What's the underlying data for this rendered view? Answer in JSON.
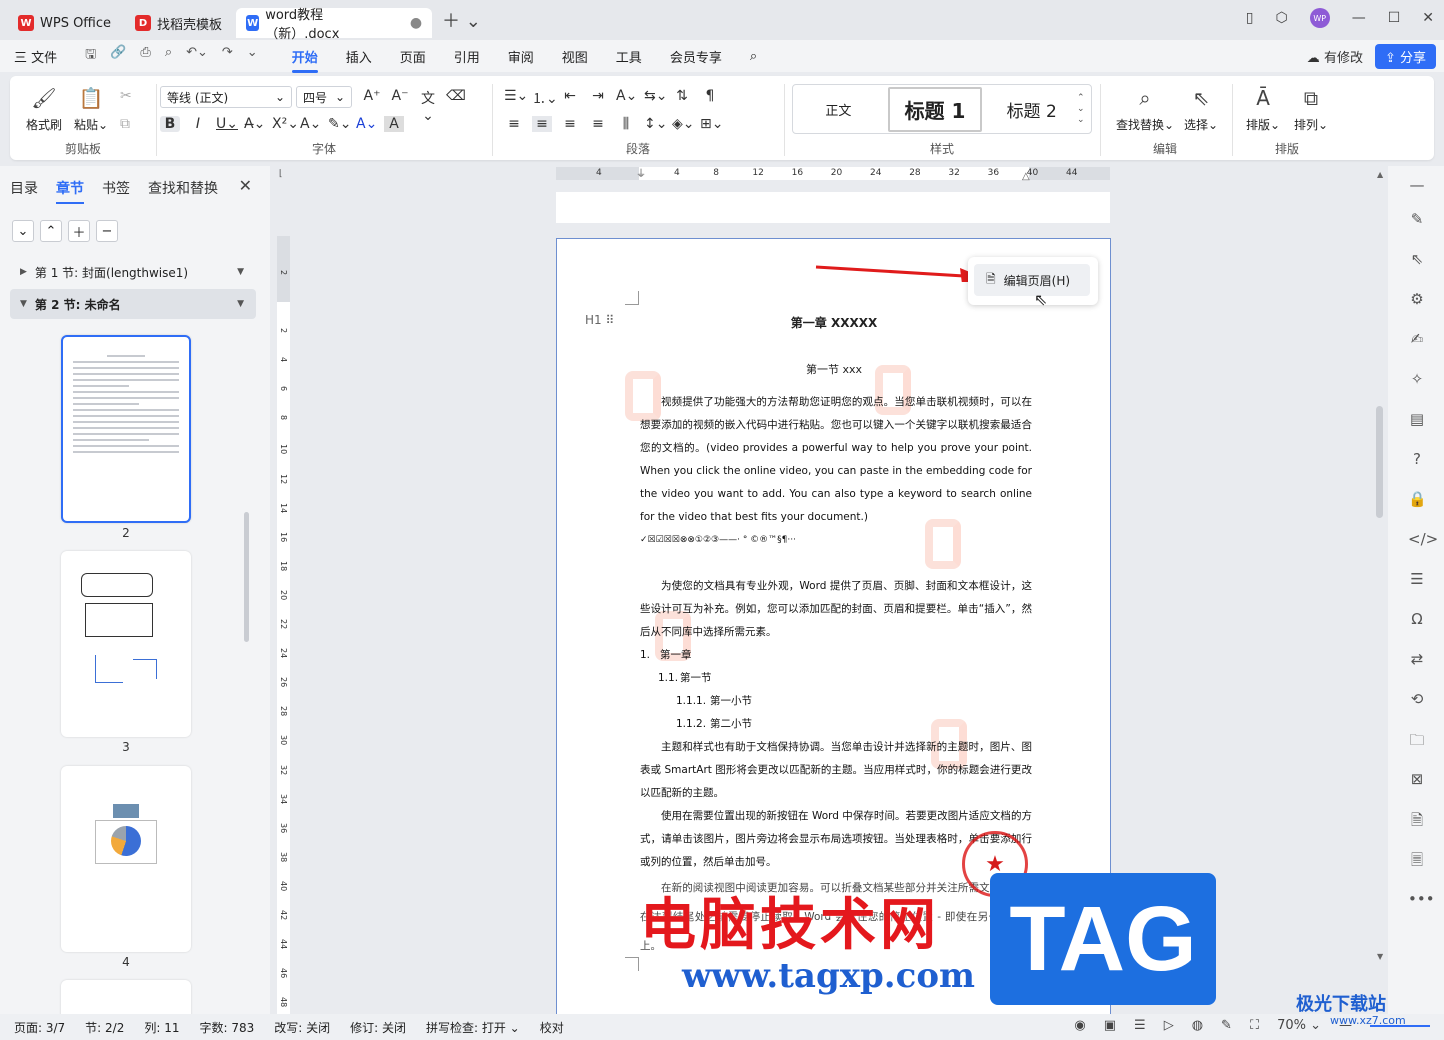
{
  "titlebar": {
    "tabs": [
      {
        "label": "WPS Office",
        "logo": "W",
        "color": "#e32b2b"
      },
      {
        "label": "找稻壳模板",
        "logo": "D",
        "color": "#e32b2b"
      },
      {
        "label": "word教程（新）.docx",
        "logo": "W",
        "color": "#2f6df6"
      }
    ],
    "avatar": "WP"
  },
  "menubar": {
    "file": "三 文件",
    "tabs": [
      "开始",
      "插入",
      "页面",
      "引用",
      "审阅",
      "视图",
      "工具",
      "会员专享"
    ],
    "active": "开始",
    "modified": "有修改",
    "share": "分享"
  },
  "ribbon": {
    "clipboard": {
      "label": "剪贴板",
      "format_painter": "格式刷",
      "paste": "粘贴"
    },
    "font": {
      "label": "字体",
      "family": "等线 (正文)",
      "size": "四号"
    },
    "paragraph": {
      "label": "段落"
    },
    "styles": {
      "label": "样式",
      "items": [
        "正文",
        "标题 1",
        "标题 2"
      ]
    },
    "edit": {
      "label": "编辑",
      "find_replace": "查找替换",
      "select": "选择"
    },
    "layout": {
      "label": "排版",
      "arrange_text": "排版",
      "arrange": "排列"
    }
  },
  "leftpanel": {
    "tabs": [
      "目录",
      "章节",
      "书签",
      "查找和替换"
    ],
    "active": "章节",
    "sections": [
      "第 1 节: 封面(lengthwise1)",
      "第 2 节: 未命名"
    ],
    "thumbs": [
      "2",
      "3",
      "4"
    ]
  },
  "ruler": {
    "h": [
      "4",
      "4",
      "8",
      "12",
      "16",
      "20",
      "24",
      "28",
      "32",
      "36",
      "40",
      "44"
    ],
    "v": [
      "2",
      "2",
      "4",
      "6",
      "8",
      "10",
      "12",
      "14",
      "16",
      "18",
      "20",
      "22",
      "24",
      "26",
      "28",
      "30",
      "32",
      "34",
      "36",
      "38",
      "40",
      "42",
      "44",
      "46",
      "48"
    ]
  },
  "document": {
    "chapter": "第一章  XXXXX",
    "section": "第一节  xxx",
    "p1": "视频提供了功能强大的方法帮助您证明您的观点。当您单击联机视频时，可以在想要添加的视频的嵌入代码中进行粘贴。您也可以键入一个关键字以联机搜索最适合您的文档的。(video provides a powerful way to help you prove your point. When you click the online video, you can paste in the embedding code for the video you want to add. You can also type a keyword to search online for the video that best fits your document.)",
    "symbols": "✓☒☑☒☒⊗⊗①②③——·    °  ©®™§¶···",
    "p2": "为使您的文档具有专业外观，Word 提供了页眉、页脚、封面和文本框设计，这些设计可互为补充。例如，您可以添加匹配的封面、页眉和提要栏。单击“插入”，然后从不同库中选择所需元素。",
    "list": [
      {
        "num": "1.",
        "text": "第一章",
        "indent": 0
      },
      {
        "num": "1.1.",
        "text": "第一节",
        "indent": 18
      },
      {
        "num": "1.1.1.",
        "text": "第一小节",
        "indent": 36
      },
      {
        "num": "1.1.2.",
        "text": "第二小节",
        "indent": 36
      }
    ],
    "p3": "主题和样式也有助于文档保持协调。当您单击设计并选择新的主题时，图片、图表或 SmartArt 图形将会更改以匹配新的主题。当应用样式时，你的标题会进行更改以匹配新的主题。",
    "p4": "使用在需要位置出现的新按钮在 Word 中保存时间。若要更改图片适应文档的方式，请单击该图片，图片旁边将会显示布局选项按钮。当处理表格时，单击要添加行或列的位置，然后单击加号。",
    "p5": "在新的阅读视图中阅读更加容易。可以折叠文档某些部分并关注所需文本。如果在达到结尾处之前需要停止读取，Word 会记住您的停止位置 - 即使在另一个设备上。",
    "h1_marker": "H1"
  },
  "context_menu": {
    "edit_header": "编辑页眉(H)"
  },
  "statusbar": {
    "page": "页面: 3/7",
    "section": "节: 2/2",
    "column": "列: 11",
    "words": "字数: 783",
    "overtype": "改写: 关闭",
    "revision": "修订: 关闭",
    "spell": "拼写检查: 打开",
    "proof": "校对",
    "zoom": "70%"
  },
  "overlay": {
    "title": "电脑技术网",
    "url": "www.tagxp.com",
    "tag": "TAG",
    "site_logo": "极光下载站",
    "site_url": "www.xz7.com"
  }
}
